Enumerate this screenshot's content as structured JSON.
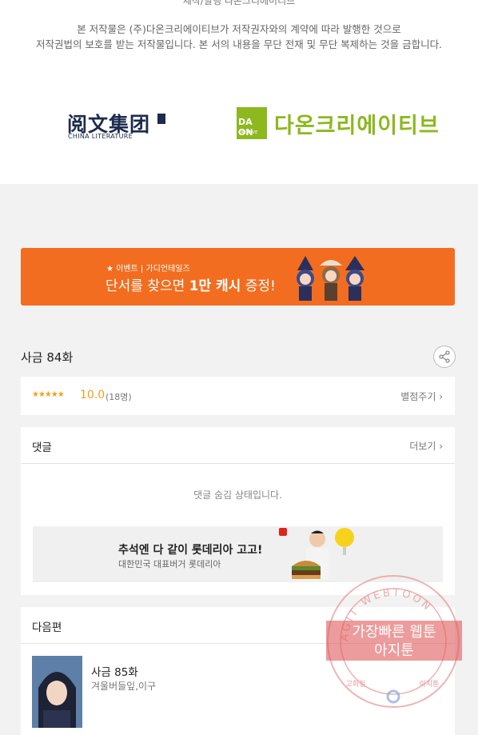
{
  "publisher": {
    "cut_text": "제작/발행 다온크리에이티브",
    "copyright_line1": "본 저작물은 (주)다온크리에이티브가 저작권자와의 계약에 따라 발행한 것으로",
    "copyright_line2": "저작권법의 보호를 받는 저작물입니다. 본 서의 내용을 무단 전재 및 무단 복제하는 것을 금합니다.",
    "logo_cl_cn": "阅文集团",
    "logo_cl_en": "CHINA LITERATURE",
    "logo_daon_box_top": "DA ON",
    "logo_daon_box_bottom": "CREATIVE",
    "logo_daon_name": "다온크리에이티브"
  },
  "event_banner": {
    "tag": "★ 이벤트 | 가디언테일즈",
    "headline_pre": "단서를 찾으면 ",
    "headline_bold": "1만 캐시",
    "headline_post": " 증정!"
  },
  "episode": {
    "title": "사금 84화",
    "stars": "★★★★★",
    "score": "10.0",
    "count": "(18명)",
    "rate_link": "별점주기 ›"
  },
  "comments": {
    "title": "댓글",
    "more": "더보기 ›",
    "hidden_message": "댓글 숨김 상태입니다."
  },
  "ad": {
    "title": "추석엔 다 같이 롯데리아 고고!",
    "subtitle": "대한민국 대표버거 롯데리아"
  },
  "next": {
    "section_title": "다음편",
    "title": "사금 85화",
    "author": "겨울버들잎,이구"
  },
  "watermark": {
    "ring": "AGIT WEBTOON",
    "line1": "가장빠른 웹툰",
    "line2": "아지툰",
    "bottom_left": "고화질",
    "bottom_right": "아지툰"
  },
  "colors": {
    "banner": "#f26d1f",
    "star": "#f2a01c",
    "daon_green": "#8db81e",
    "cl_navy": "#1d2b4f",
    "stamp": "#e05a5a"
  }
}
